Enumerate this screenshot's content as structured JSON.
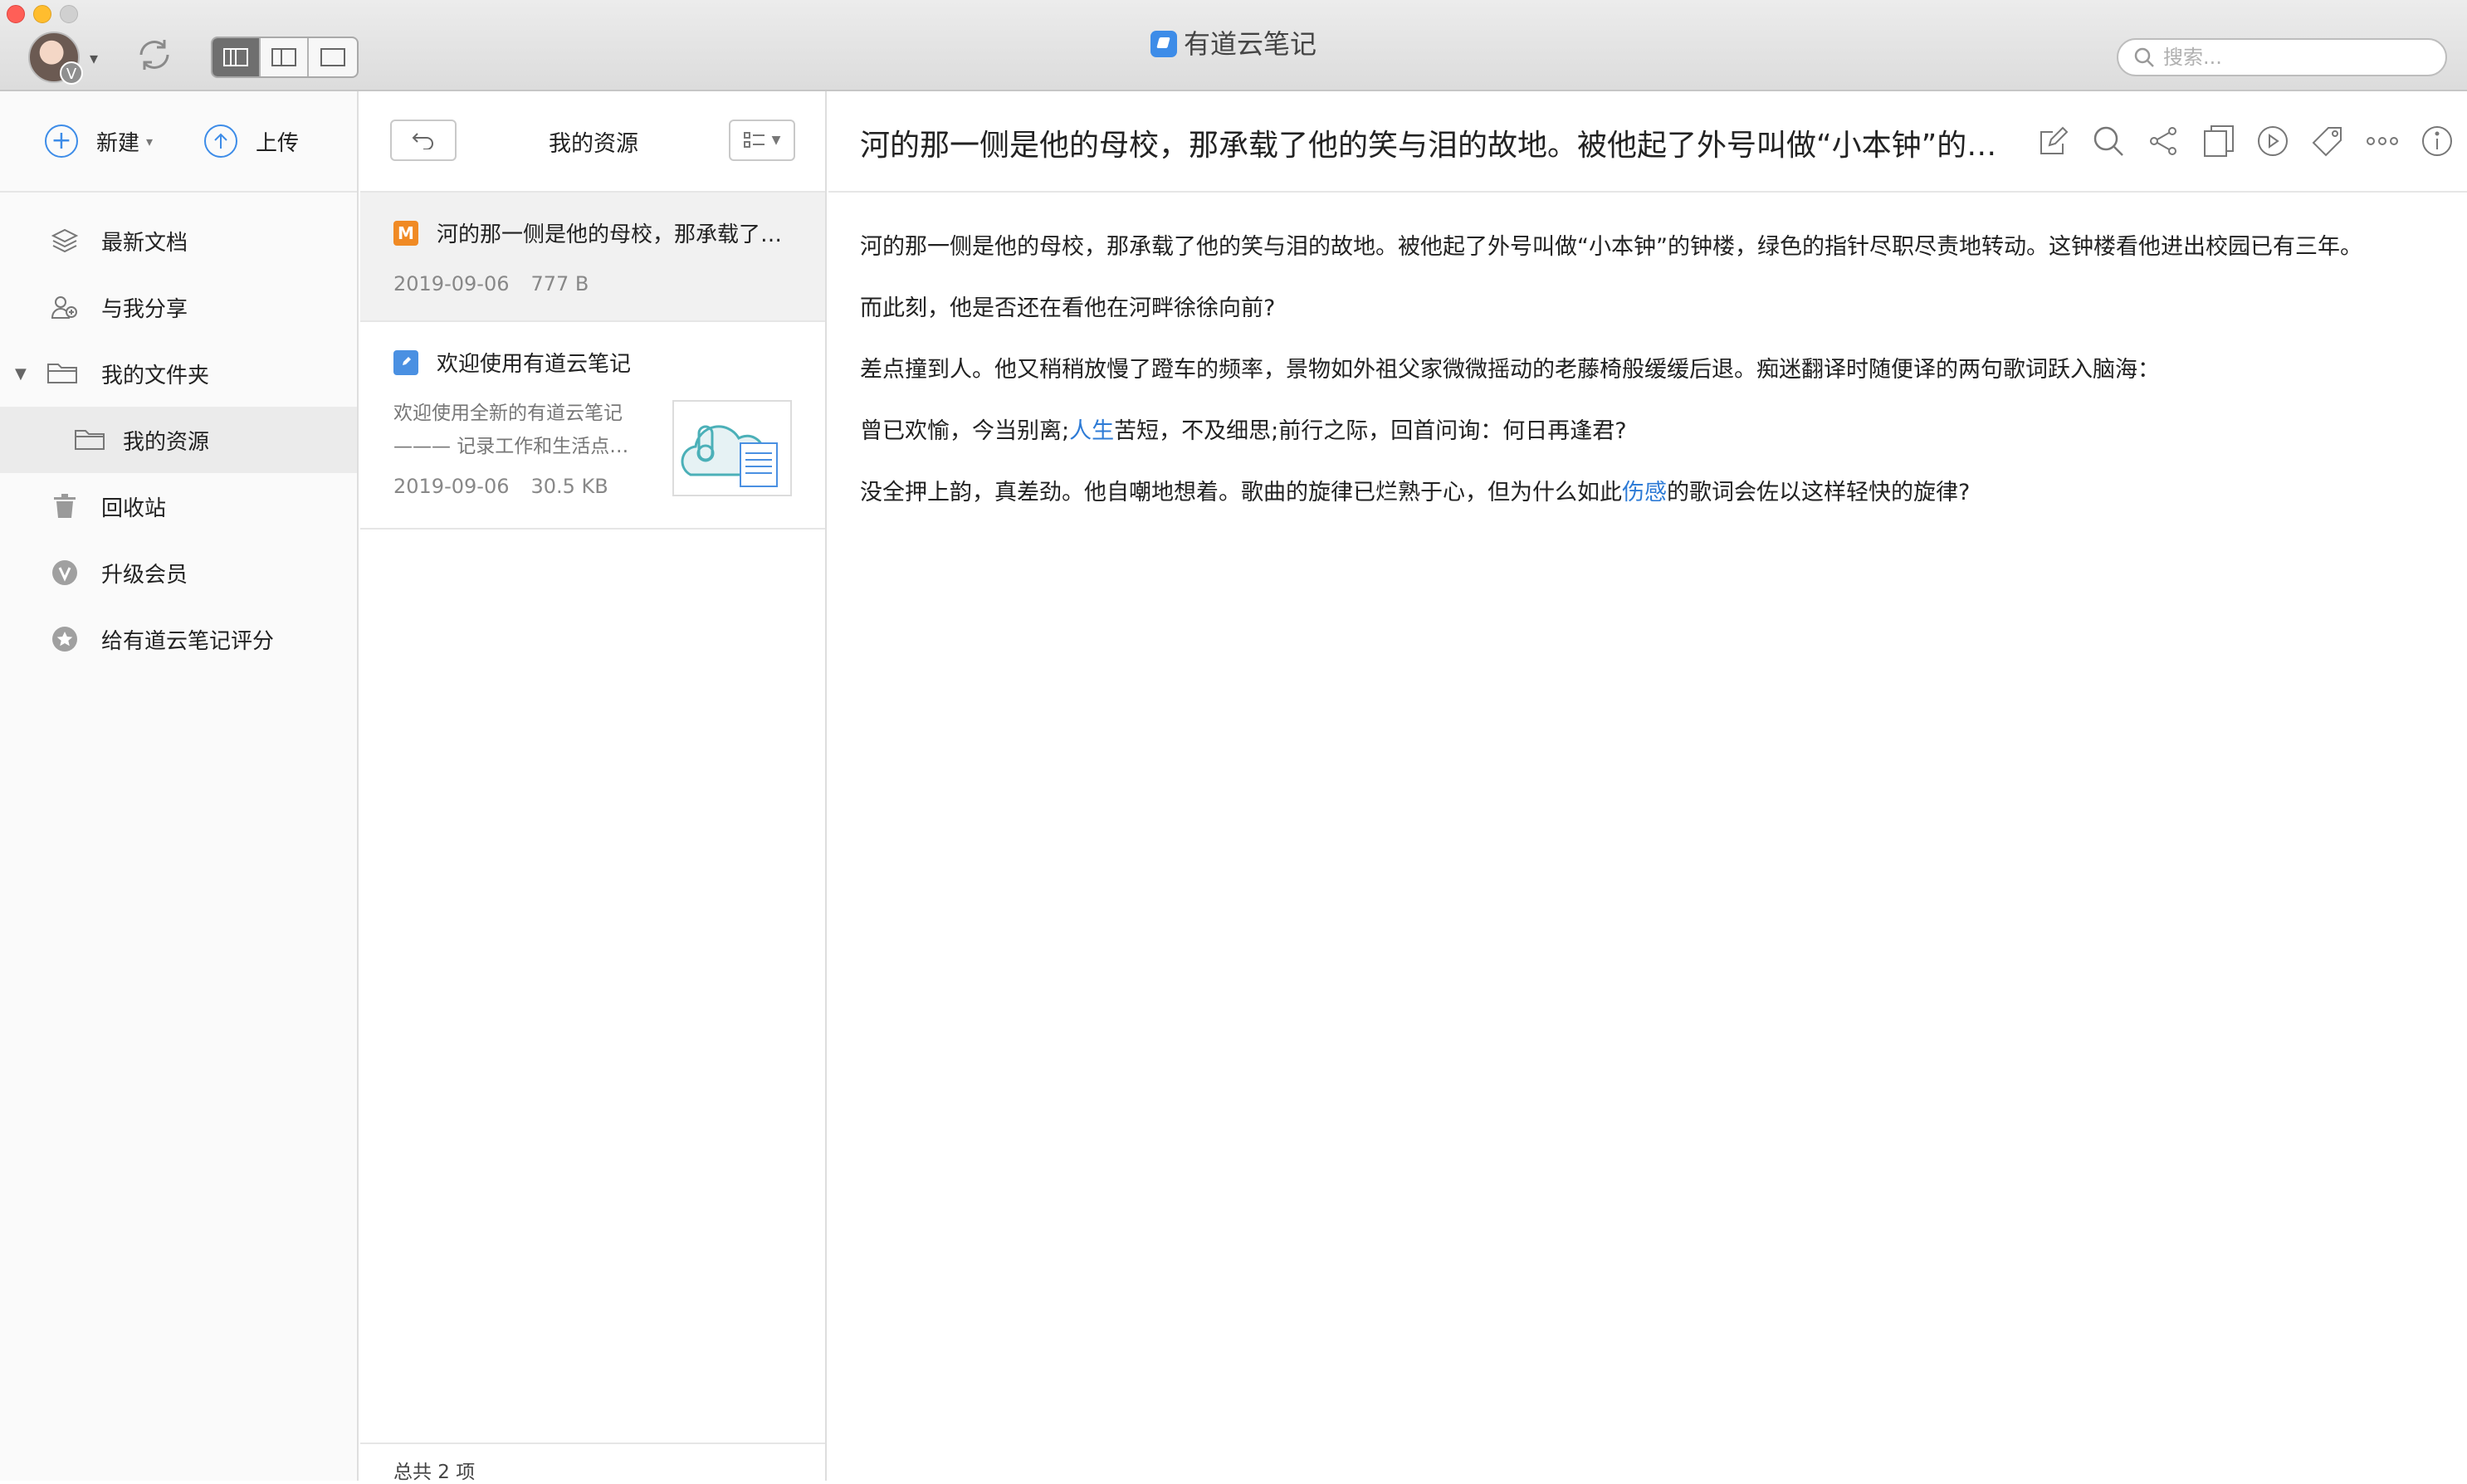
{
  "app": {
    "title": "有道云笔记"
  },
  "search": {
    "placeholder": "搜索..."
  },
  "account": {
    "badge": "V"
  },
  "sidebar": {
    "actions": [
      {
        "label": "新建",
        "icon": "plus-icon"
      },
      {
        "label": "上传",
        "icon": "upload-icon"
      }
    ],
    "items": [
      {
        "label": "最新文档",
        "icon": "layers-icon"
      },
      {
        "label": "与我分享",
        "icon": "share-users-icon"
      },
      {
        "label": "我的文件夹",
        "icon": "folder-open-icon"
      },
      {
        "label": "我的资源",
        "icon": "folder-icon"
      },
      {
        "label": "回收站",
        "icon": "trash-icon"
      },
      {
        "label": "升级会员",
        "icon": "vip-icon"
      },
      {
        "label": "给有道云笔记评分",
        "icon": "star-icon"
      }
    ]
  },
  "list": {
    "title": "我的资源",
    "notes": [
      {
        "badge": "M",
        "title": "河的那一侧是他的母校，那承载了…",
        "date": "2019-09-06",
        "size": "777 B"
      },
      {
        "title": "欢迎使用有道云笔记",
        "snippet_line1": "欢迎使用全新的有道云笔记",
        "snippet_line2": "——— 记录工作和生活点…",
        "date": "2019-09-06",
        "size": "30.5 KB"
      }
    ],
    "footer": "总共 2 项"
  },
  "editor": {
    "title": "河的那一侧是他的母校，那承载了他的笑与泪的故地。被他起了外号叫做“小本钟”的…",
    "p1": "河的那一侧是他的母校，那承载了他的笑与泪的故地。被他起了外号叫做“小本钟”的钟楼，绿色的指针尽职尽责地转动。这钟楼看他进出校园已有三年。",
    "p2": "而此刻，他是否还在看他在河畔徐徐向前?",
    "p3": "差点撞到人。他又稍稍放慢了蹬车的频率，景物如外祖父家微微摇动的老藤椅般缓缓后退。痴迷翻译时随便译的两句歌词跃入脑海：",
    "p4_a": "曾已欢愉，今当别离;",
    "p4_link": "人生",
    "p4_b": "苦短，不及细思;前行之际，回首问询：何日再逢君?",
    "p5_a": "没全押上韵，真差劲。他自嘲地想着。歌曲的旋律已烂熟于心，但为什么如此",
    "p5_link": "伤感",
    "p5_b": "的歌词会佐以这样轻快的旋律?"
  },
  "colors": {
    "accent": "#3d8ce8",
    "link": "#2e7bd6",
    "markdown_badge": "#f08a24"
  }
}
